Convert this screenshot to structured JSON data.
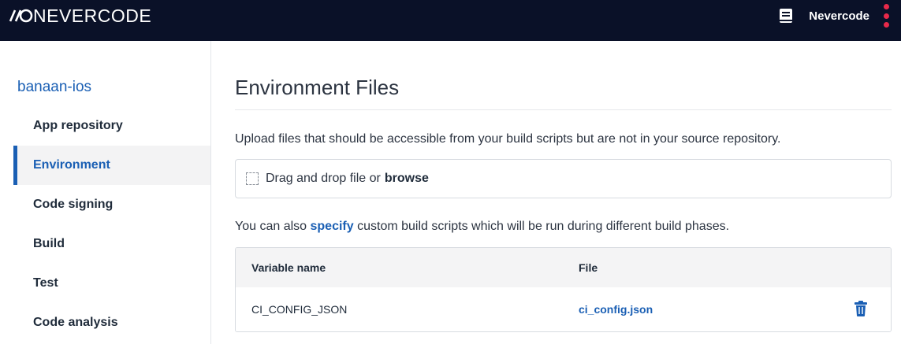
{
  "header": {
    "logo_text": "NEVERCODE",
    "user_name": "Nevercode",
    "accent_color": "#e8294a",
    "background_color": "#0a1128",
    "icons": [
      "logo-mark-icon",
      "docs-icon",
      "kebab-menu-icon"
    ]
  },
  "sidebar": {
    "project_name": "banaan-ios",
    "items": [
      {
        "label": "App repository",
        "active": false
      },
      {
        "label": "Environment",
        "active": true
      },
      {
        "label": "Code signing",
        "active": false
      },
      {
        "label": "Build",
        "active": false
      },
      {
        "label": "Test",
        "active": false
      },
      {
        "label": "Code analysis",
        "active": false
      }
    ],
    "active_color": "#1a5fb4"
  },
  "main": {
    "title": "Environment Files",
    "intro": "Upload files that should be accessible from your build scripts but are not in your source repository.",
    "dropzone": {
      "text": "Drag and drop file or",
      "browse_label": "browse"
    },
    "scripts_line": {
      "before": "You can also",
      "link": "specify",
      "after": "custom build scripts which will be run during different build phases."
    },
    "table": {
      "columns": [
        "Variable name",
        "File"
      ],
      "rows": [
        {
          "variable": "CI_CONFIG_JSON",
          "file": "ci_config.json"
        }
      ]
    }
  }
}
